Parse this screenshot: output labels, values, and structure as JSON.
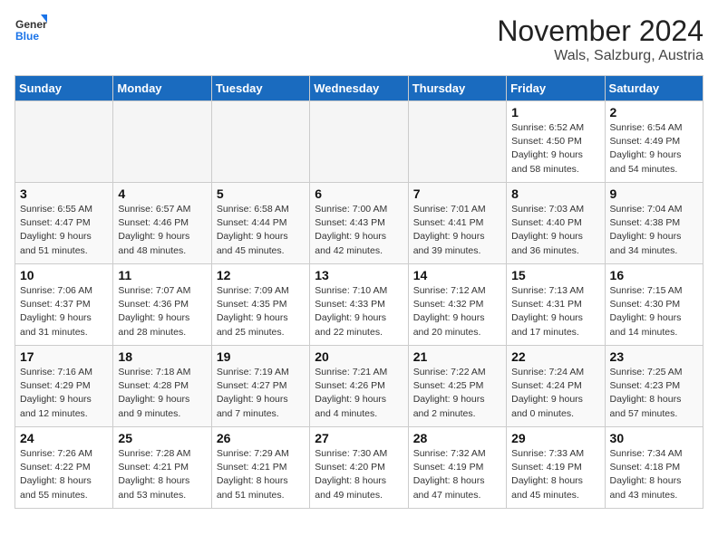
{
  "logo": {
    "line1": "General",
    "line2": "Blue"
  },
  "title": "November 2024",
  "subtitle": "Wals, Salzburg, Austria",
  "days_of_week": [
    "Sunday",
    "Monday",
    "Tuesday",
    "Wednesday",
    "Thursday",
    "Friday",
    "Saturday"
  ],
  "weeks": [
    [
      {
        "day": "",
        "info": ""
      },
      {
        "day": "",
        "info": ""
      },
      {
        "day": "",
        "info": ""
      },
      {
        "day": "",
        "info": ""
      },
      {
        "day": "",
        "info": ""
      },
      {
        "day": "1",
        "info": "Sunrise: 6:52 AM\nSunset: 4:50 PM\nDaylight: 9 hours and 58 minutes."
      },
      {
        "day": "2",
        "info": "Sunrise: 6:54 AM\nSunset: 4:49 PM\nDaylight: 9 hours and 54 minutes."
      }
    ],
    [
      {
        "day": "3",
        "info": "Sunrise: 6:55 AM\nSunset: 4:47 PM\nDaylight: 9 hours and 51 minutes."
      },
      {
        "day": "4",
        "info": "Sunrise: 6:57 AM\nSunset: 4:46 PM\nDaylight: 9 hours and 48 minutes."
      },
      {
        "day": "5",
        "info": "Sunrise: 6:58 AM\nSunset: 4:44 PM\nDaylight: 9 hours and 45 minutes."
      },
      {
        "day": "6",
        "info": "Sunrise: 7:00 AM\nSunset: 4:43 PM\nDaylight: 9 hours and 42 minutes."
      },
      {
        "day": "7",
        "info": "Sunrise: 7:01 AM\nSunset: 4:41 PM\nDaylight: 9 hours and 39 minutes."
      },
      {
        "day": "8",
        "info": "Sunrise: 7:03 AM\nSunset: 4:40 PM\nDaylight: 9 hours and 36 minutes."
      },
      {
        "day": "9",
        "info": "Sunrise: 7:04 AM\nSunset: 4:38 PM\nDaylight: 9 hours and 34 minutes."
      }
    ],
    [
      {
        "day": "10",
        "info": "Sunrise: 7:06 AM\nSunset: 4:37 PM\nDaylight: 9 hours and 31 minutes."
      },
      {
        "day": "11",
        "info": "Sunrise: 7:07 AM\nSunset: 4:36 PM\nDaylight: 9 hours and 28 minutes."
      },
      {
        "day": "12",
        "info": "Sunrise: 7:09 AM\nSunset: 4:35 PM\nDaylight: 9 hours and 25 minutes."
      },
      {
        "day": "13",
        "info": "Sunrise: 7:10 AM\nSunset: 4:33 PM\nDaylight: 9 hours and 22 minutes."
      },
      {
        "day": "14",
        "info": "Sunrise: 7:12 AM\nSunset: 4:32 PM\nDaylight: 9 hours and 20 minutes."
      },
      {
        "day": "15",
        "info": "Sunrise: 7:13 AM\nSunset: 4:31 PM\nDaylight: 9 hours and 17 minutes."
      },
      {
        "day": "16",
        "info": "Sunrise: 7:15 AM\nSunset: 4:30 PM\nDaylight: 9 hours and 14 minutes."
      }
    ],
    [
      {
        "day": "17",
        "info": "Sunrise: 7:16 AM\nSunset: 4:29 PM\nDaylight: 9 hours and 12 minutes."
      },
      {
        "day": "18",
        "info": "Sunrise: 7:18 AM\nSunset: 4:28 PM\nDaylight: 9 hours and 9 minutes."
      },
      {
        "day": "19",
        "info": "Sunrise: 7:19 AM\nSunset: 4:27 PM\nDaylight: 9 hours and 7 minutes."
      },
      {
        "day": "20",
        "info": "Sunrise: 7:21 AM\nSunset: 4:26 PM\nDaylight: 9 hours and 4 minutes."
      },
      {
        "day": "21",
        "info": "Sunrise: 7:22 AM\nSunset: 4:25 PM\nDaylight: 9 hours and 2 minutes."
      },
      {
        "day": "22",
        "info": "Sunrise: 7:24 AM\nSunset: 4:24 PM\nDaylight: 9 hours and 0 minutes."
      },
      {
        "day": "23",
        "info": "Sunrise: 7:25 AM\nSunset: 4:23 PM\nDaylight: 8 hours and 57 minutes."
      }
    ],
    [
      {
        "day": "24",
        "info": "Sunrise: 7:26 AM\nSunset: 4:22 PM\nDaylight: 8 hours and 55 minutes."
      },
      {
        "day": "25",
        "info": "Sunrise: 7:28 AM\nSunset: 4:21 PM\nDaylight: 8 hours and 53 minutes."
      },
      {
        "day": "26",
        "info": "Sunrise: 7:29 AM\nSunset: 4:21 PM\nDaylight: 8 hours and 51 minutes."
      },
      {
        "day": "27",
        "info": "Sunrise: 7:30 AM\nSunset: 4:20 PM\nDaylight: 8 hours and 49 minutes."
      },
      {
        "day": "28",
        "info": "Sunrise: 7:32 AM\nSunset: 4:19 PM\nDaylight: 8 hours and 47 minutes."
      },
      {
        "day": "29",
        "info": "Sunrise: 7:33 AM\nSunset: 4:19 PM\nDaylight: 8 hours and 45 minutes."
      },
      {
        "day": "30",
        "info": "Sunrise: 7:34 AM\nSunset: 4:18 PM\nDaylight: 8 hours and 43 minutes."
      }
    ]
  ]
}
